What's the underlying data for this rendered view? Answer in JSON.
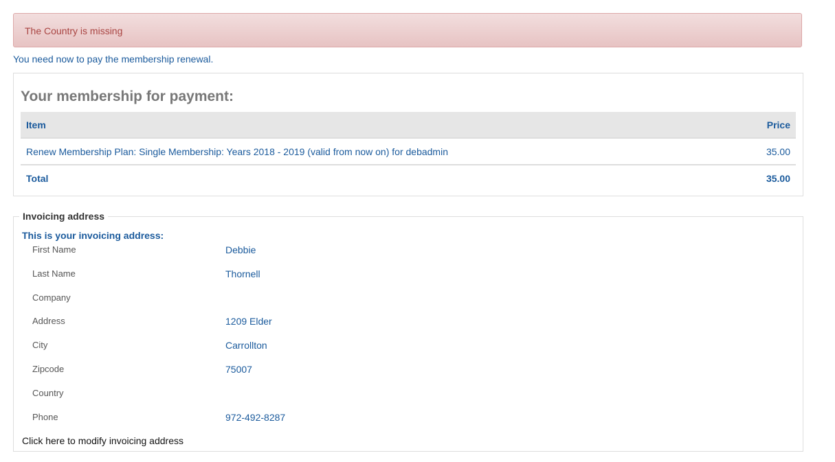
{
  "alert": {
    "message": "The Country is missing"
  },
  "notice": "You need now to pay the membership renewal.",
  "membership": {
    "title": "Your membership for payment:",
    "columns": {
      "item": "Item",
      "price": "Price"
    },
    "rows": [
      {
        "item": "Renew Membership Plan: Single Membership: Years 2018 - 2019 (valid from now on) for debadmin",
        "price": "35.00"
      }
    ],
    "total": {
      "label": "Total",
      "value": "35.00"
    }
  },
  "invoice": {
    "legend": "Invoicing address",
    "heading": "This is your invoicing address:",
    "fields": [
      {
        "label": "First Name",
        "value": "Debbie"
      },
      {
        "label": "Last Name",
        "value": "Thornell"
      },
      {
        "label": "Company",
        "value": ""
      },
      {
        "label": "Address",
        "value": "1209 Elder"
      },
      {
        "label": "City",
        "value": "Carrollton"
      },
      {
        "label": "Zipcode",
        "value": "75007"
      },
      {
        "label": "Country",
        "value": ""
      },
      {
        "label": "Phone",
        "value": "972-492-8287"
      }
    ],
    "modify_link": "Click here to modify invoicing address"
  },
  "colors": {
    "alert_bg": "#f2dede",
    "alert_text": "#a94442",
    "link_blue": "#1a5a9c",
    "table_header_bg": "#e6e6e6"
  }
}
